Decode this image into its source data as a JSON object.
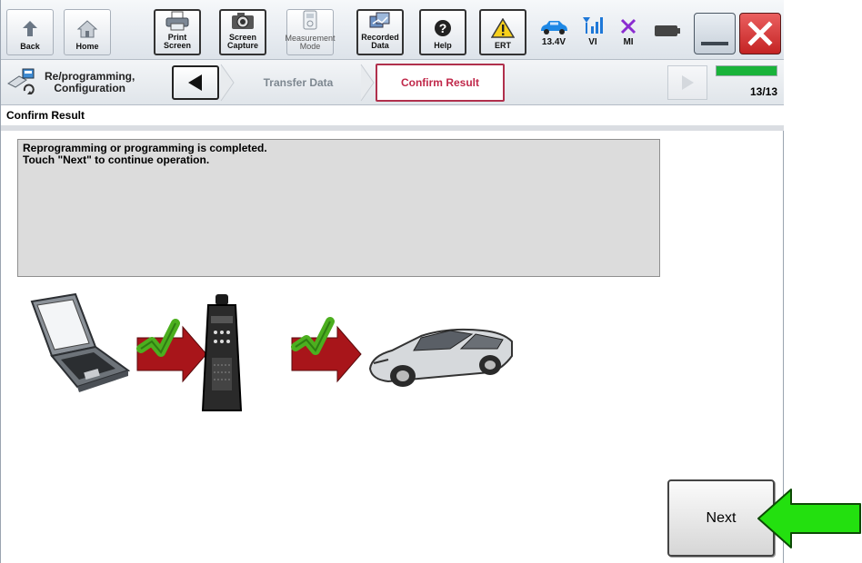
{
  "toolbar": {
    "back": "Back",
    "home": "Home",
    "print_screen": "Print Screen",
    "screen_capture_1": "Screen",
    "screen_capture_2": "Capture",
    "measurement_1": "Measurement",
    "measurement_2": "Mode",
    "recorded_1": "Recorded",
    "recorded_2": "Data",
    "help": "Help",
    "ert": "ERT",
    "voltage": "13.4V",
    "vi": "VI",
    "mi": "MI"
  },
  "breadcrumb": {
    "mode_1": "Re/programming,",
    "mode_2": "Configuration",
    "step_prev": "Transfer Data",
    "step_current": "Confirm Result",
    "progress_text": "13/13",
    "progress_fraction": 1.0
  },
  "screen": {
    "title": "Confirm Result",
    "message_1": "Reprogramming or programming is completed.",
    "message_2": "Touch \"Next\" to continue operation."
  },
  "next_label": "Next",
  "colors": {
    "accent": "#c0284a",
    "progress": "#19b33a",
    "check": "#4caf1f",
    "arrow_red": "#b3161c",
    "callout_arrow": "#23e00f"
  }
}
